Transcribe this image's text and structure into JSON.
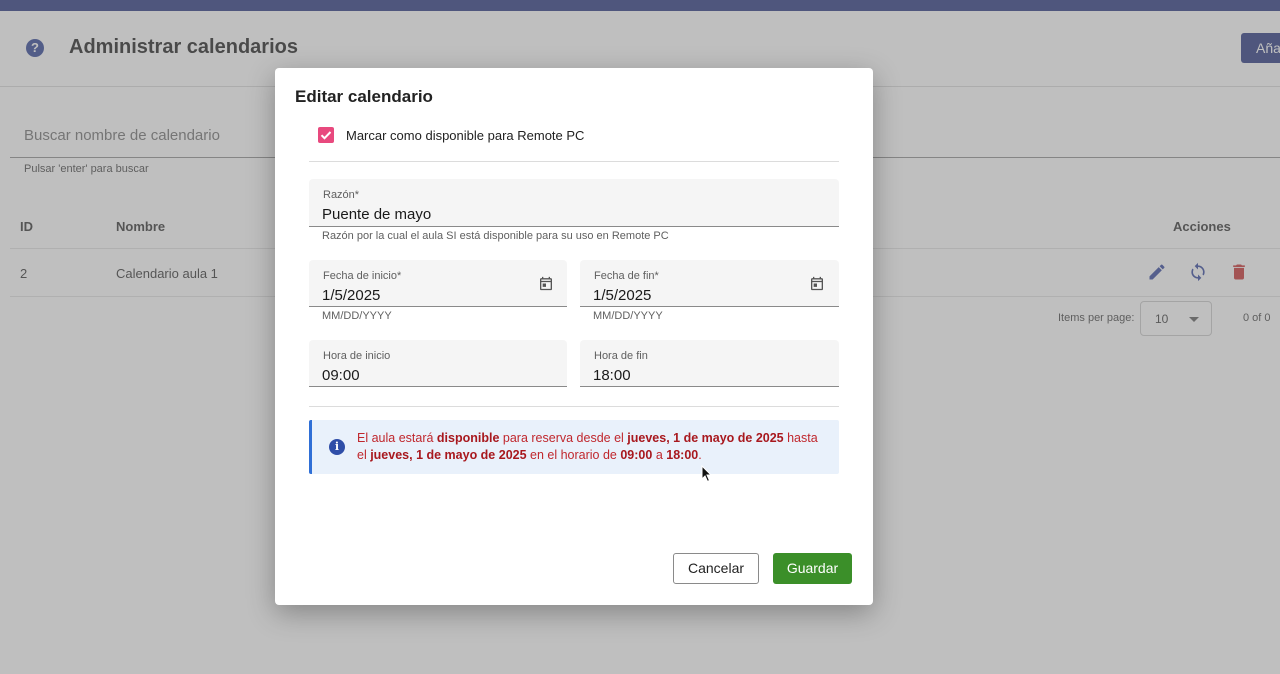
{
  "page": {
    "help_icon_glyph": "?",
    "title": "Administrar calendarios",
    "add_button_label": "Aña",
    "search_placeholder": "Buscar nombre de calendario",
    "search_hint": "Pulsar 'enter' para buscar",
    "table": {
      "headers": {
        "id": "ID",
        "name": "Nombre",
        "actions": "Acciones"
      },
      "rows": [
        {
          "id": "2",
          "name": "Calendario aula 1",
          "actions": [
            "edit-icon",
            "sync-icon",
            "delete-icon"
          ]
        }
      ]
    },
    "paginator": {
      "label": "Items per page:",
      "page_size": "10",
      "range": "0 of 0"
    },
    "colors": {
      "brand": "#1f2d7a",
      "edit": "#2a3f9a",
      "sync": "#2a3f9a",
      "delete": "#c62828"
    }
  },
  "dialog": {
    "title": "Editar calendario",
    "available_checkbox": {
      "label": "Marcar como disponible para Remote PC",
      "checked": true,
      "color": "#e8497e"
    },
    "reason": {
      "label": "Razón*",
      "value": "Puente de mayo",
      "hint": "Razón por la cual el aula SI está disponible para su uso en Remote PC"
    },
    "start_date": {
      "label": "Fecha de inicio*",
      "value": "1/5/2025",
      "hint": "MM/DD/YYYY",
      "icon": "calendar-icon"
    },
    "end_date": {
      "label": "Fecha de fin*",
      "value": "1/5/2025",
      "hint": "MM/DD/YYYY",
      "icon": "calendar-icon"
    },
    "start_time": {
      "label": "Hora de inicio",
      "value": "09:00"
    },
    "end_time": {
      "label": "Hora de fin",
      "value": "18:00"
    },
    "info": {
      "icon_glyph": "i",
      "p1": "El aula estará ",
      "b1": "disponible",
      "p2": " para reserva desde el ",
      "b2": "jueves, 1 de mayo de 2025",
      "p3": " hasta el ",
      "b3": "jueves, 1 de mayo de 2025",
      "p4": " en el horario de ",
      "b4": "09:00",
      "p5": " a ",
      "b5": "18:00",
      "p6": "."
    },
    "cancel_label": "Cancelar",
    "save_label": "Guardar",
    "colors": {
      "save": "#3b8f29",
      "info_text": "#c0272d",
      "info_accent": "#2f6fd6"
    }
  }
}
